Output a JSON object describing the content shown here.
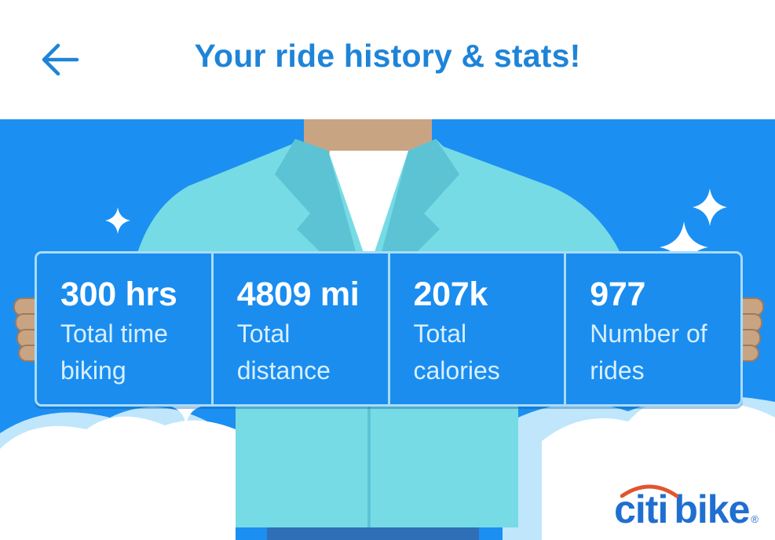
{
  "header": {
    "title": "Your ride history & stats!"
  },
  "stats": [
    {
      "value": "300 hrs",
      "label": "Total time biking"
    },
    {
      "value": "4809 mi",
      "label": "Total distance"
    },
    {
      "value": "207k",
      "label": "Total calories"
    },
    {
      "value": "977",
      "label": "Number of rides"
    }
  ],
  "logo": {
    "part1": "citi",
    "part2": "bike",
    "mark": "®"
  },
  "icons": {
    "back": "arrow-left-icon",
    "sparkle": "sparkle-icon"
  },
  "colors": {
    "accent": "#1e84d8",
    "hero_background": "#1c8ff2",
    "jacket": "#76dbe4",
    "skin": "#c9a483",
    "logo_arc": "#e0552f"
  }
}
